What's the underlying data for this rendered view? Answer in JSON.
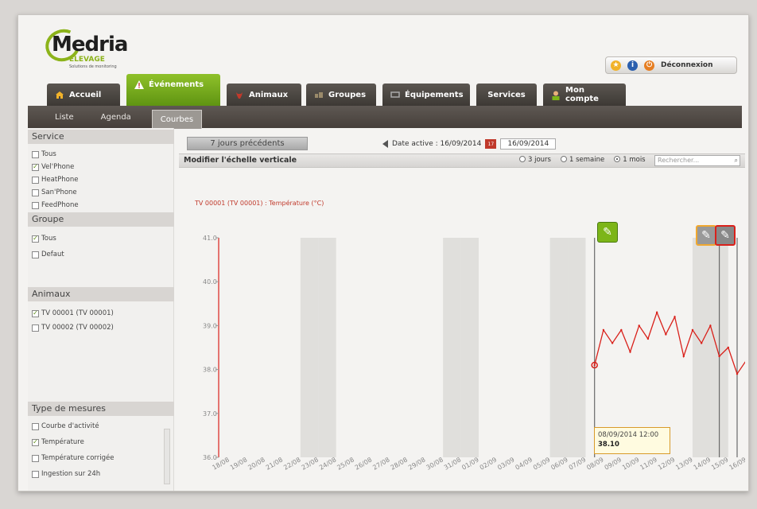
{
  "logo": {
    "brand": "Medria",
    "subtitle": "ELEVAGE",
    "tagline": "Solutions de monitoring"
  },
  "user_bar": {
    "logout_label": "Déconnexion",
    "icons": [
      "star-icon",
      "info-icon",
      "power-icon"
    ]
  },
  "main_tabs": [
    {
      "label": "Accueil",
      "icon": "home-icon"
    },
    {
      "label": "Événements",
      "icon": "warning-icon",
      "active": true
    },
    {
      "label": "Animaux",
      "icon": "cow-icon"
    },
    {
      "label": "Groupes",
      "icon": "group-icon"
    },
    {
      "label": "Équipements",
      "icon": "equipment-icon"
    },
    {
      "label": "Services",
      "icon": ""
    },
    {
      "label": "Mon compte",
      "icon": "user-icon"
    }
  ],
  "sub_tabs": [
    {
      "label": "Liste"
    },
    {
      "label": "Agenda"
    },
    {
      "label": "Courbes",
      "active": true
    }
  ],
  "sidebar": {
    "service": {
      "title": "Service",
      "items": [
        {
          "label": "Tous",
          "checked": false
        },
        {
          "label": "Vel'Phone",
          "checked": true
        },
        {
          "label": "HeatPhone",
          "checked": false
        },
        {
          "label": "San'Phone",
          "checked": false
        },
        {
          "label": "FeedPhone",
          "checked": false
        }
      ]
    },
    "groupe": {
      "title": "Groupe",
      "items": [
        {
          "label": "Tous",
          "checked": true
        },
        {
          "label": "Defaut",
          "checked": false
        }
      ]
    },
    "animaux": {
      "title": "Animaux",
      "items": [
        {
          "label": "TV 00001 (TV 00001)",
          "checked": true
        },
        {
          "label": "TV 00002 (TV 00002)",
          "checked": false
        }
      ]
    },
    "mesures": {
      "title": "Type de mesures",
      "items": [
        {
          "label": "Courbe d'activité",
          "checked": false
        },
        {
          "label": "Température",
          "checked": true
        },
        {
          "label": "Température corrigée",
          "checked": false
        },
        {
          "label": "Ingestion sur 24h",
          "checked": false
        }
      ]
    }
  },
  "toolbar": {
    "prev_button": "7 jours précédents",
    "active_date_label": "Date active : 16/09/2014",
    "date_value": "16/09/2014",
    "calendar_day": "17",
    "scale_label": "Modifier l'échelle verticale",
    "period_options": [
      {
        "label": "3 jours",
        "selected": false
      },
      {
        "label": "1 semaine",
        "selected": false
      },
      {
        "label": "1 mois",
        "selected": true
      }
    ],
    "search_placeholder": "Rechercher..."
  },
  "curve_title": "TV 00001 (TV 00001) : Température (°C)",
  "tooltip": {
    "date": "08/09/2014 12:00",
    "value": "38.10"
  },
  "colors": {
    "accent_green": "#7cb518",
    "series_red": "#d9201a",
    "header_dark": "#4a4540"
  },
  "chart_data": {
    "type": "line",
    "title": "TV 00001 (TV 00001) : Température (°C)",
    "ylim": [
      36.0,
      41.0
    ],
    "yticks": [
      "41.0",
      "40.0",
      "39.0",
      "38.0",
      "37.0",
      "36.0"
    ],
    "xticks": [
      "18/08",
      "19/08",
      "20/08",
      "21/08",
      "22/08",
      "23/08",
      "24/08",
      "25/08",
      "26/08",
      "27/08",
      "28/08",
      "29/08",
      "30/08",
      "31/08",
      "01/09",
      "02/09",
      "03/09",
      "04/09",
      "05/09",
      "06/09",
      "07/09",
      "08/09",
      "09/09",
      "10/09",
      "11/09",
      "12/09",
      "13/09",
      "14/09",
      "15/09",
      "16/09"
    ],
    "series": [
      {
        "values": [
          {
            "x": "08/09",
            "y": 38.1
          },
          {
            "x": "08/09",
            "y": 38.9
          },
          {
            "x": "09/09",
            "y": 38.6
          },
          {
            "x": "09/09",
            "y": 38.9
          },
          {
            "x": "10/09",
            "y": 38.4
          },
          {
            "x": "10/09",
            "y": 39.0
          },
          {
            "x": "11/09",
            "y": 38.7
          },
          {
            "x": "11/09",
            "y": 39.3
          },
          {
            "x": "12/09",
            "y": 38.8
          },
          {
            "x": "12/09",
            "y": 39.2
          },
          {
            "x": "13/09",
            "y": 38.3
          },
          {
            "x": "13/09",
            "y": 38.9
          },
          {
            "x": "14/09",
            "y": 38.6
          },
          {
            "x": "14/09",
            "y": 39.0
          },
          {
            "x": "15/09",
            "y": 38.3
          },
          {
            "x": "15/09",
            "y": 38.5
          },
          {
            "x": "16/09",
            "y": 37.9
          },
          {
            "x": "16/09",
            "y": 38.2
          }
        ]
      }
    ],
    "shaded_days": [
      "23/08",
      "24/08",
      "31/08",
      "01/09",
      "06/09",
      "07/09",
      "14/09",
      "15/09"
    ],
    "event_markers": [
      "08/09",
      "15/09",
      "16/09"
    ],
    "grid": false
  }
}
